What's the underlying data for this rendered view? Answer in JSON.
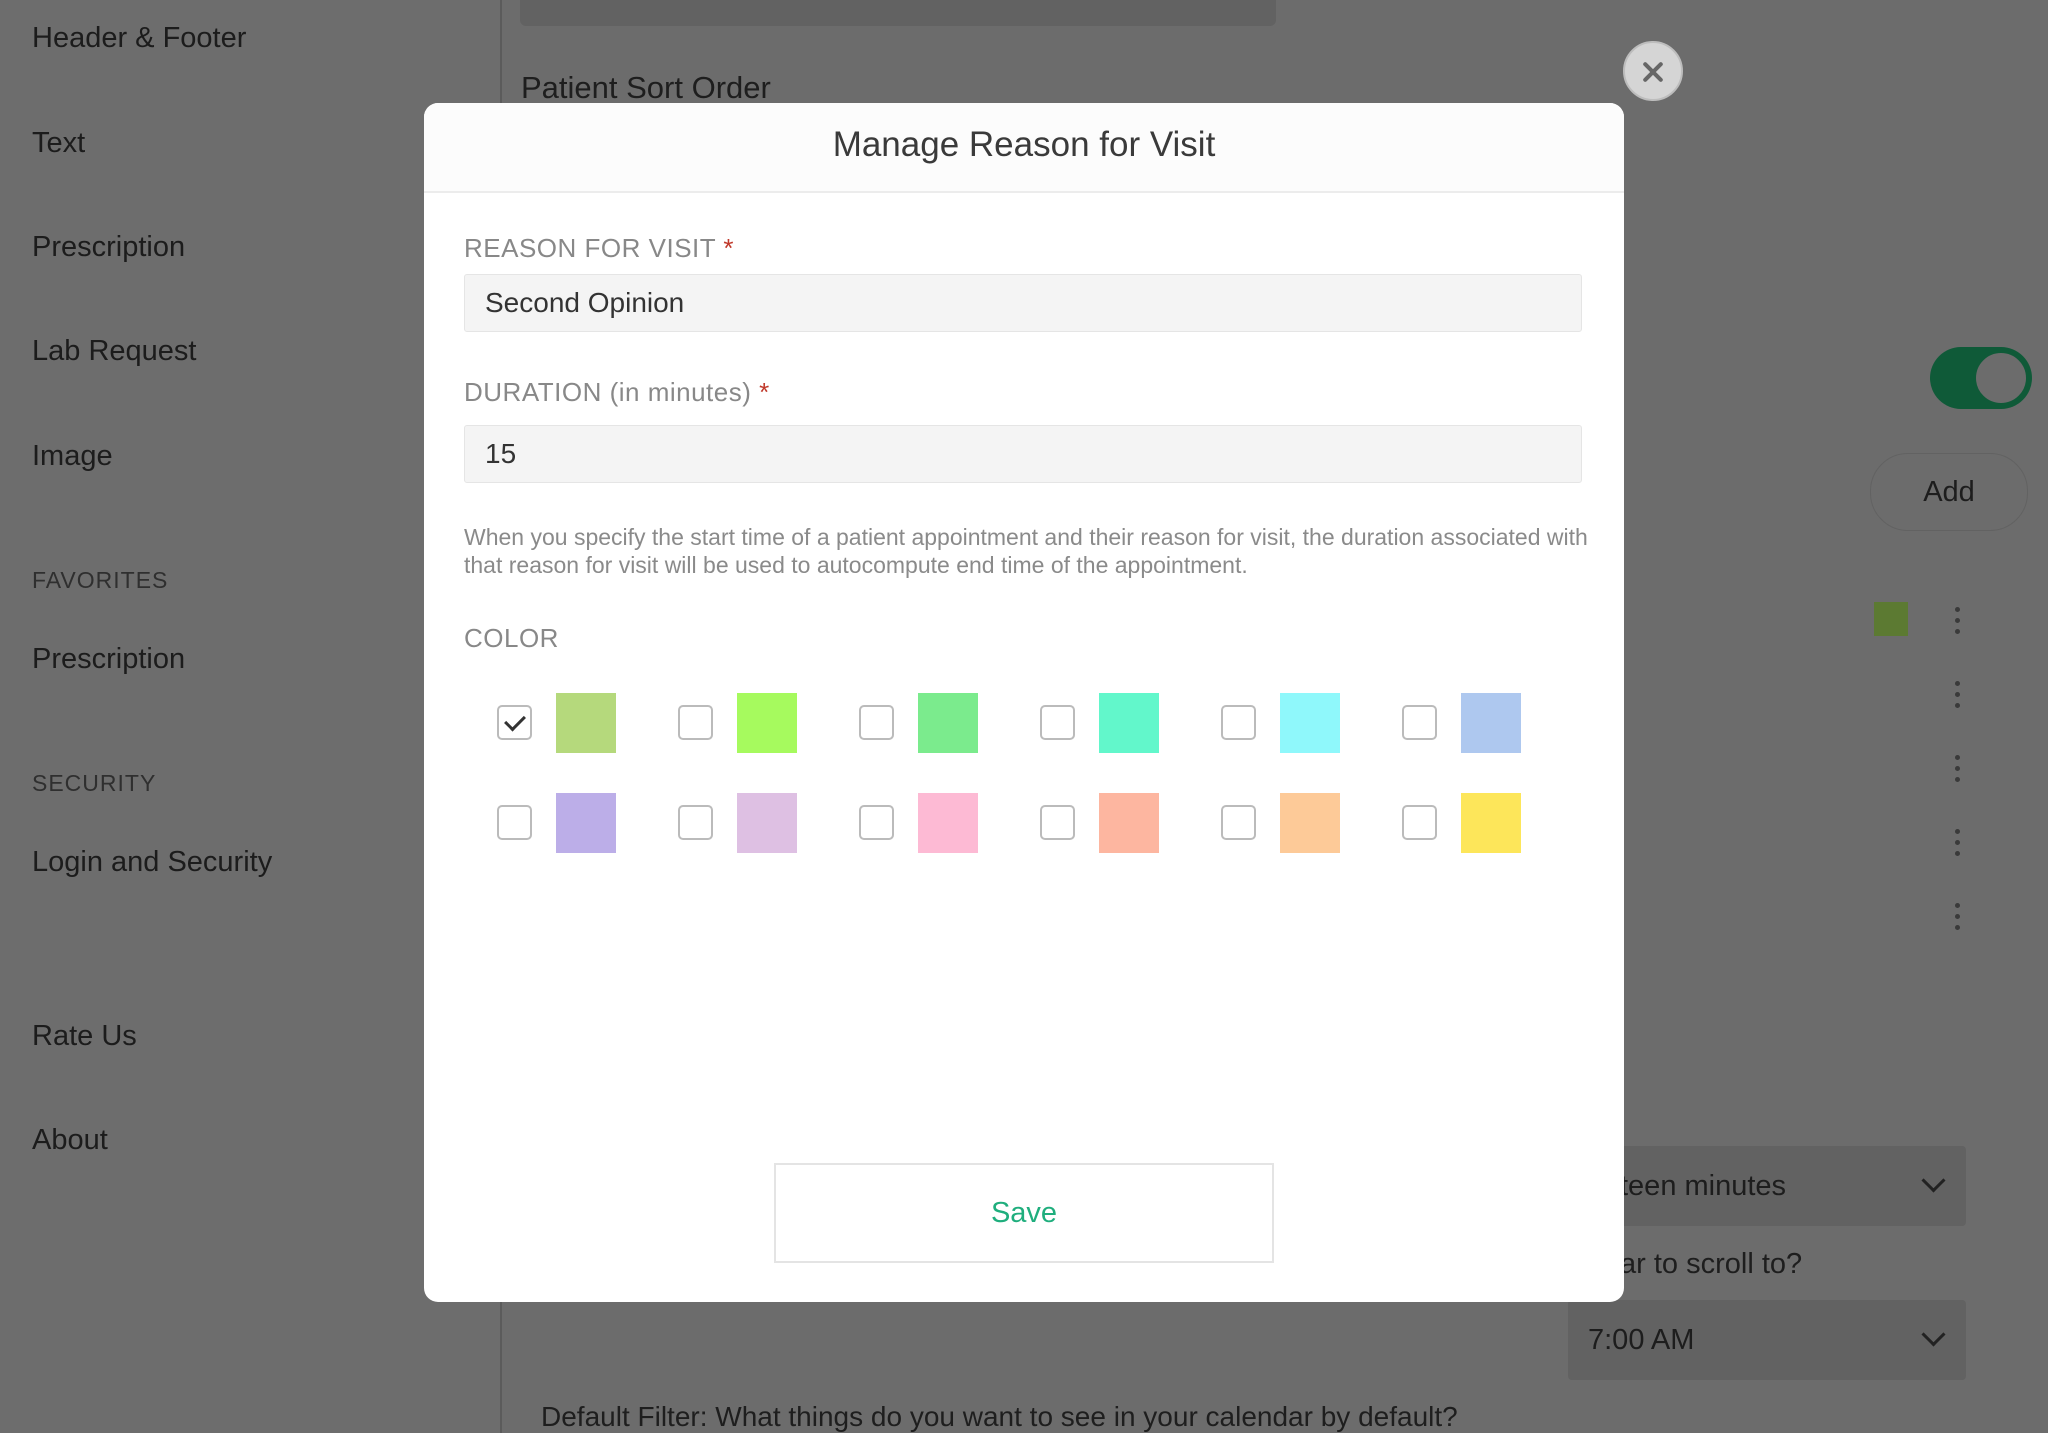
{
  "sidebar": {
    "items": [
      {
        "label": "Header & Footer"
      },
      {
        "label": "Text"
      },
      {
        "label": "Prescription"
      },
      {
        "label": "Lab Request"
      },
      {
        "label": "Image"
      }
    ],
    "favorites_heading": "FAVORITES",
    "favorites": [
      {
        "label": "Prescription"
      }
    ],
    "security_heading": "SECURITY",
    "security": [
      {
        "label": "Login and Security"
      }
    ],
    "bottom": [
      {
        "label": "Rate Us"
      },
      {
        "label": "About"
      }
    ]
  },
  "background": {
    "section_title": "Patient Sort Order",
    "add_label": "Add",
    "interval_value": "teen minutes",
    "scroll_question": "ar to scroll to?",
    "scroll_value": "7:00 AM",
    "filter_question": "Default Filter: What things do you want to see in your calendar by default?",
    "toggle_on": true,
    "accent_swatch": "#5c7a32"
  },
  "modal": {
    "title": "Manage Reason for Visit",
    "reason_label": "REASON FOR VISIT",
    "reason_value": "Second Opinion",
    "duration_label": "DURATION (in minutes)",
    "duration_value": "15",
    "required_mark": "*",
    "hint": "When you specify the start time of a patient appointment and their reason for visit, the duration associated with that reason for visit will be used to autocompute end time of the appointment.",
    "color_label": "COLOR",
    "colors": [
      {
        "hex": "#b5d97c",
        "checked": true
      },
      {
        "hex": "#a6fa5e",
        "checked": false
      },
      {
        "hex": "#7beb8d",
        "checked": false
      },
      {
        "hex": "#62f7cb",
        "checked": false
      },
      {
        "hex": "#8ff8fb",
        "checked": false
      },
      {
        "hex": "#aec8ef",
        "checked": false
      },
      {
        "hex": "#bcaee8",
        "checked": false
      },
      {
        "hex": "#dec0e3",
        "checked": false
      },
      {
        "hex": "#fdbad4",
        "checked": false
      },
      {
        "hex": "#fdb6a0",
        "checked": false
      },
      {
        "hex": "#fdca98",
        "checked": false
      },
      {
        "hex": "#fde65a",
        "checked": false
      }
    ],
    "save_label": "Save",
    "save_color": "#1fae7d"
  }
}
